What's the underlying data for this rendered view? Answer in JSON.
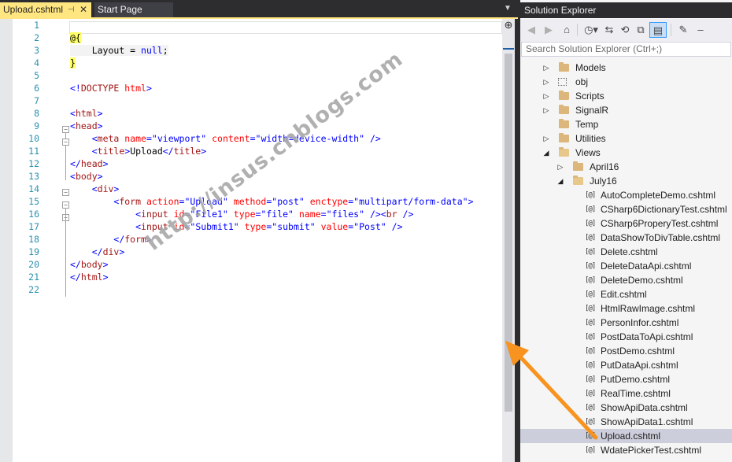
{
  "tabs": [
    {
      "label": "Upload.cshtml",
      "active": true
    },
    {
      "label": "Start Page",
      "active": false
    }
  ],
  "line_numbers": [
    "1",
    "2",
    "3",
    "4",
    "5",
    "6",
    "7",
    "8",
    "9",
    "10",
    "11",
    "12",
    "13",
    "14",
    "15",
    "16",
    "17",
    "18",
    "19",
    "20",
    "21",
    "22"
  ],
  "code": {
    "l2": "@{",
    "l3_kw": "Layout",
    "l3_eq": " = ",
    "l3_null": "null",
    "l3_semi": ";",
    "l4": "}",
    "l6_open": "<!",
    "l6_tag": "DOCTYPE",
    "l6_attr": " html",
    "l6_close": ">",
    "html_tag": "html",
    "head_tag": "head",
    "meta_tag": "meta",
    "name_attr": "name",
    "viewport_val": "\"viewport\"",
    "content_attr": "content",
    "content_val": "\"width=device-width\"",
    "title_tag": "title",
    "title_text": "Upload",
    "body_tag": "body",
    "div_tag": "div",
    "form_tag": "form",
    "action_attr": "action",
    "action_val": "\"Upload\"",
    "method_attr": "method",
    "method_val": "\"post\"",
    "enctype_attr": "enctype",
    "enctype_val": "\"multipart/form-data\"",
    "input_tag": "input",
    "id_attr": "id",
    "file1_val": "\"File1\"",
    "type_attr": "type",
    "file_val": "\"file\"",
    "files_val": "\"files\"",
    "br_tag": "br",
    "submit1_val": "\"Submit1\"",
    "submit_val": "\"submit\"",
    "value_attr": "value",
    "post_val": "\"Post\""
  },
  "watermark": "http://insus.cnblogs.com",
  "solution_explorer": {
    "title": "Solution Explorer",
    "search_placeholder": "Search Solution Explorer (Ctrl+;)",
    "items": [
      {
        "label": "Models",
        "kind": "folder",
        "expander": "closed"
      },
      {
        "label": "obj",
        "kind": "hidden-folder",
        "expander": "closed"
      },
      {
        "label": "Scripts",
        "kind": "folder",
        "expander": "closed"
      },
      {
        "label": "SignalR",
        "kind": "folder",
        "expander": "closed"
      },
      {
        "label": "Temp",
        "kind": "folder",
        "expander": "none"
      },
      {
        "label": "Utilities",
        "kind": "folder",
        "expander": "closed"
      },
      {
        "label": "Views",
        "kind": "folder-open",
        "expander": "open"
      },
      {
        "label": "April16",
        "kind": "folder",
        "expander": "closed"
      },
      {
        "label": "July16",
        "kind": "folder-open",
        "expander": "open"
      },
      {
        "label": "AutoCompleteDemo.cshtml",
        "kind": "file"
      },
      {
        "label": "CSharp6DictionaryTest.cshtml",
        "kind": "file"
      },
      {
        "label": "CSharp6ProperyTest.cshtml",
        "kind": "file"
      },
      {
        "label": "DataShowToDivTable.cshtml",
        "kind": "file"
      },
      {
        "label": "Delete.cshtml",
        "kind": "file"
      },
      {
        "label": "DeleteDataApi.cshtml",
        "kind": "file"
      },
      {
        "label": "DeleteDemo.cshtml",
        "kind": "file"
      },
      {
        "label": "Edit.cshtml",
        "kind": "file"
      },
      {
        "label": "HtmlRawImage.cshtml",
        "kind": "file"
      },
      {
        "label": "PersonInfor.cshtml",
        "kind": "file"
      },
      {
        "label": "PostDataToApi.cshtml",
        "kind": "file"
      },
      {
        "label": "PostDemo.cshtml",
        "kind": "file"
      },
      {
        "label": "PutDataApi.cshtml",
        "kind": "file"
      },
      {
        "label": "PutDemo.cshtml",
        "kind": "file"
      },
      {
        "label": "RealTime.cshtml",
        "kind": "file"
      },
      {
        "label": "ShowApiData.cshtml",
        "kind": "file"
      },
      {
        "label": "ShowApiData1.cshtml",
        "kind": "file"
      },
      {
        "label": "Upload.cshtml",
        "kind": "file",
        "selected": true
      },
      {
        "label": "WdatePickerTest.cshtml",
        "kind": "file"
      }
    ]
  },
  "colors": {
    "tab_active": "#ffe680",
    "ide_dark": "#2d2d30",
    "line_number": "#2b91af",
    "html_tag": "#a31515",
    "html_attr": "#ff0000",
    "html_string": "#0000ff",
    "razor_highlight": "#ffff66",
    "selection": "#cccedb",
    "arrow": "#f7931e"
  },
  "icons": [
    "pin-icon",
    "close-icon",
    "dropdown-icon",
    "split-icon",
    "back-icon",
    "forward-icon",
    "home-icon",
    "history-icon",
    "sync-icon",
    "collapse-icon",
    "copy-icon",
    "show-all-icon",
    "properties-icon",
    "pin-pane-icon",
    "folder-icon",
    "razor-file-icon"
  ]
}
